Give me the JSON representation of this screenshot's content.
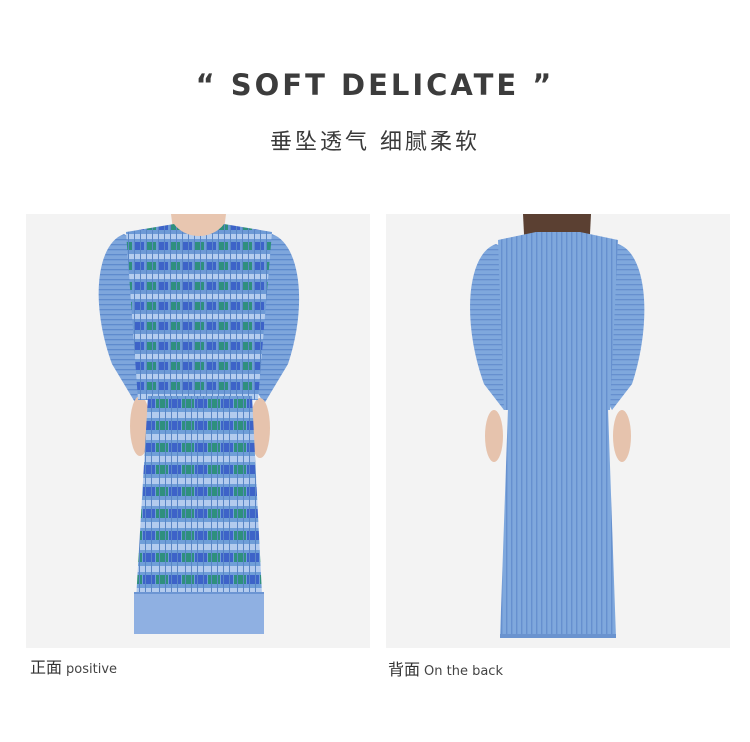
{
  "header": {
    "title": "“ SOFT DELICATE ”",
    "subtitle": "垂坠透气   细腻柔软"
  },
  "photos": [
    {
      "view": "front",
      "caption_cn": "正面",
      "caption_en": "positive",
      "colors": {
        "base": "#6d9ad6",
        "stripe_light": "#a8c4ea",
        "stripe_green": "#2f8f7e",
        "stripe_blue": "#3d63c8"
      }
    },
    {
      "view": "back",
      "caption_cn": "背面",
      "caption_en": "On the back",
      "colors": {
        "base": "#7ea7dc",
        "pleat": "#6b94cf"
      }
    }
  ]
}
